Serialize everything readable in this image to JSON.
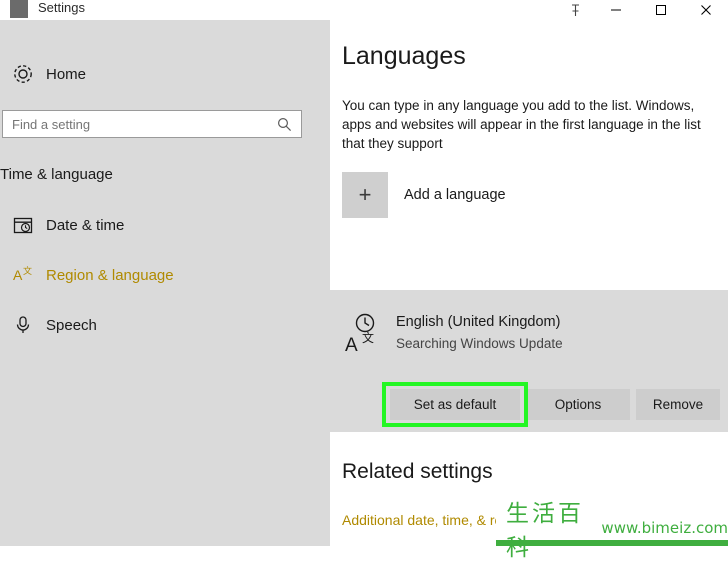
{
  "window": {
    "title": "Settings",
    "buttons": {
      "pin": "pin-icon",
      "minimize": "─",
      "maximize": "☐",
      "close": "✕"
    }
  },
  "sidebar": {
    "home": {
      "label": "Home",
      "icon": "gear-icon"
    },
    "search": {
      "value": "",
      "placeholder": "Find a setting",
      "icon": "search-icon"
    },
    "group_title": "Time & language",
    "items": [
      {
        "label": "Date & time",
        "icon": "calendar-clock-icon",
        "selected": false
      },
      {
        "label": "Region & language",
        "icon": "language-a-icon",
        "selected": true
      },
      {
        "label": "Speech",
        "icon": "microphone-icon",
        "selected": false
      }
    ]
  },
  "main": {
    "title": "Languages",
    "description": "You can type in any language you add to the list. Windows, apps and websites will appear in the first language in the list that they support",
    "add_language": {
      "label": "Add a language",
      "icon": "plus-icon"
    },
    "language_card": {
      "icon": "language-keyboard-icon",
      "name": "English (United Kingdom)",
      "status": "Searching Windows Update",
      "buttons": {
        "set_default": "Set as default",
        "options": "Options",
        "remove": "Remove"
      },
      "highlight_color": "#24f624"
    },
    "related": {
      "title": "Related settings",
      "link": "Additional date, time, & reg..."
    }
  },
  "watermark": {
    "logo": "生活百科",
    "url": "www.bimeiz.com",
    "color": "#3fae3f"
  }
}
